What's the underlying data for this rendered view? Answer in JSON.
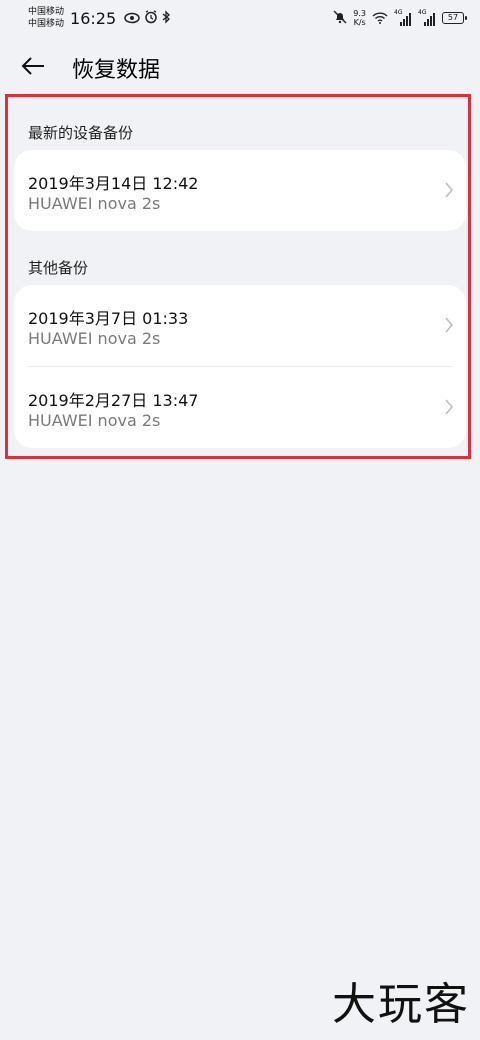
{
  "status_bar": {
    "carrier_1": "中国移动",
    "carrier_2": "中国移动",
    "time": "16:25",
    "speed_value": "9.3",
    "speed_unit": "K/s",
    "signal_1_label": "4G",
    "signal_2_label": "4G",
    "battery": "57"
  },
  "app_bar": {
    "title": "恢复数据"
  },
  "sections": [
    {
      "title": "最新的设备备份",
      "items": [
        {
          "date": "2019年3月14日 12:42",
          "device": "HUAWEI nova 2s"
        }
      ]
    },
    {
      "title": "其他备份",
      "items": [
        {
          "date": "2019年3月7日 01:33",
          "device": "HUAWEI nova 2s"
        },
        {
          "date": "2019年2月27日 13:47",
          "device": "HUAWEI nova 2s"
        }
      ]
    }
  ],
  "watermark": "大玩客",
  "colors": {
    "background": "#f1f2f5",
    "card": "#ffffff",
    "highlight": "#d9323c",
    "secondary_text": "#7a7a7a"
  }
}
